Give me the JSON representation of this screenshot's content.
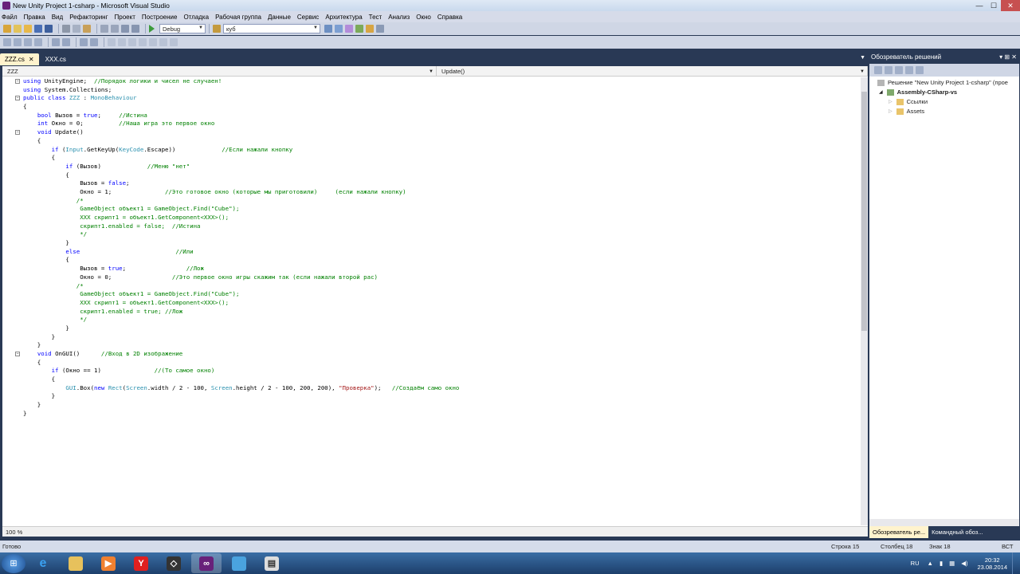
{
  "window": {
    "title": "New Unity Project 1-csharp - Microsoft Visual Studio",
    "minimize": "—",
    "maximize": "☐",
    "close": "✕"
  },
  "menu": [
    "Файл",
    "Правка",
    "Вид",
    "Рефакторинг",
    "Проект",
    "Построение",
    "Отладка",
    "Рабочая группа",
    "Данные",
    "Сервис",
    "Архитектура",
    "Тест",
    "Анализ",
    "Окно",
    "Справка"
  ],
  "toolbar": {
    "config": "Debug",
    "search": "куб"
  },
  "tabs": [
    {
      "label": "ZZZ.cs",
      "active": true,
      "close": "✕"
    },
    {
      "label": "XXX.cs",
      "active": false
    }
  ],
  "editor": {
    "nav_left": "ZZZ",
    "nav_right": "Update()",
    "zoom": "100 %",
    "code": [
      [
        [
          "kw",
          "using"
        ],
        [
          "pl",
          " UnityEngine;  "
        ],
        [
          "cm",
          "//Порядок логики и чисел не случаен!"
        ]
      ],
      [
        [
          "kw",
          "using"
        ],
        [
          "pl",
          " System.Collections;"
        ]
      ],
      [
        [
          "kw",
          "public"
        ],
        [
          "pl",
          " "
        ],
        [
          "kw",
          "class"
        ],
        [
          "pl",
          " "
        ],
        [
          "ty",
          "ZZZ"
        ],
        [
          "pl",
          " : "
        ],
        [
          "ty",
          "MonoBehaviour"
        ]
      ],
      [
        [
          "pl",
          "{"
        ]
      ],
      [
        [
          "pl",
          "    "
        ],
        [
          "kw",
          "bool"
        ],
        [
          "pl",
          " Вызов = "
        ],
        [
          "kw",
          "true"
        ],
        [
          "pl",
          ";     "
        ],
        [
          "cm",
          "//Истина"
        ]
      ],
      [
        [
          "pl",
          "    "
        ],
        [
          "kw",
          "int"
        ],
        [
          "pl",
          " Окно = 0;          "
        ],
        [
          "cm",
          "//Наша игра это первое окно"
        ]
      ],
      [
        [
          "pl",
          "    "
        ],
        [
          "kw",
          "void"
        ],
        [
          "pl",
          " Update()"
        ]
      ],
      [
        [
          "pl",
          "    {"
        ]
      ],
      [
        [
          "pl",
          "        "
        ],
        [
          "kw",
          "if"
        ],
        [
          "pl",
          " ("
        ],
        [
          "ty",
          "Input"
        ],
        [
          "pl",
          ".GetKeyUp("
        ],
        [
          "ty",
          "KeyCode"
        ],
        [
          "pl",
          ".Escape))             "
        ],
        [
          "cm",
          "//Если нажали кнопку"
        ]
      ],
      [
        [
          "pl",
          "        {"
        ]
      ],
      [
        [
          "pl",
          "            "
        ],
        [
          "kw",
          "if"
        ],
        [
          "pl",
          " (Вызов)             "
        ],
        [
          "cm",
          "//Меню \"нет\""
        ]
      ],
      [
        [
          "pl",
          "            {"
        ]
      ],
      [
        [
          "pl",
          "                Вызов = "
        ],
        [
          "kw",
          "false"
        ],
        [
          "pl",
          ";"
        ]
      ],
      [
        [
          "pl",
          "                Окно = 1;               "
        ],
        [
          "cm",
          "//Это готовое окно (которые мы приготовили)     (если нажали кнопку)"
        ]
      ],
      [
        [
          "cm",
          "               /*"
        ]
      ],
      [
        [
          "cm",
          "                GameObject объект1 = GameObject.Find(\"Cube\");"
        ]
      ],
      [
        [
          "cm",
          "                XXX скрипт1 = объект1.GetComponent<XXX>();"
        ]
      ],
      [
        [
          "cm",
          "                скрипт1.enabled = false;  //Истина"
        ]
      ],
      [
        [
          "cm",
          "                */"
        ]
      ],
      [
        [
          "pl",
          "            }"
        ]
      ],
      [
        [
          "pl",
          "            "
        ],
        [
          "kw",
          "else"
        ],
        [
          "pl",
          "                           "
        ],
        [
          "cm",
          "//Или"
        ]
      ],
      [
        [
          "pl",
          "            {"
        ]
      ],
      [
        [
          "pl",
          "                Вызов = "
        ],
        [
          "kw",
          "true"
        ],
        [
          "pl",
          ";                 "
        ],
        [
          "cm",
          "//Лож"
        ]
      ],
      [
        [
          "pl",
          "                Окно = 0;                 "
        ],
        [
          "cm",
          "//Это первое окно игры скажим так (если нажали второй рас)"
        ]
      ],
      [
        [
          "cm",
          "               /*"
        ]
      ],
      [
        [
          "cm",
          "                GameObject объект1 = GameObject.Find(\"Cube\");"
        ]
      ],
      [
        [
          "cm",
          "                XXX скрипт1 = объект1.GetComponent<XXX>();"
        ]
      ],
      [
        [
          "cm",
          "                скрипт1.enabled = true; //Лож"
        ]
      ],
      [
        [
          "cm",
          "                */"
        ]
      ],
      [
        [
          "pl",
          "            }"
        ]
      ],
      [
        [
          "pl",
          "        }"
        ]
      ],
      [
        [
          "pl",
          "    }"
        ]
      ],
      [
        [
          "pl",
          "    "
        ],
        [
          "kw",
          "void"
        ],
        [
          "pl",
          " OnGUI()      "
        ],
        [
          "cm",
          "//Вход в 2D изображение"
        ]
      ],
      [
        [
          "pl",
          "    {"
        ]
      ],
      [
        [
          "pl",
          "        "
        ],
        [
          "kw",
          "if"
        ],
        [
          "pl",
          " (Окно == 1)               "
        ],
        [
          "cm",
          "//(То самое окно)"
        ]
      ],
      [
        [
          "pl",
          "        {"
        ]
      ],
      [
        [
          "pl",
          "            "
        ],
        [
          "ty",
          "GUI"
        ],
        [
          "pl",
          ".Box("
        ],
        [
          "kw",
          "new"
        ],
        [
          "pl",
          " "
        ],
        [
          "ty",
          "Rect"
        ],
        [
          "pl",
          "("
        ],
        [
          "ty",
          "Screen"
        ],
        [
          "pl",
          ".width / 2 - 100, "
        ],
        [
          "ty",
          "Screen"
        ],
        [
          "pl",
          ".height / 2 - 100, 200, 200), "
        ],
        [
          "st",
          "\"Проверка\""
        ],
        [
          "pl",
          ");   "
        ],
        [
          "cm",
          "//Создаём само окно"
        ]
      ],
      [
        [
          "pl",
          "        }"
        ]
      ],
      [
        [
          "pl",
          "    }"
        ]
      ],
      [
        [
          "pl",
          "}"
        ]
      ]
    ]
  },
  "solution_explorer": {
    "title": "Обозреватель решений",
    "header_buttons": "▾ ⊞ ✕",
    "solution": "Решение \"New Unity Project 1-csharp\" (прое",
    "project": "Assembly-CSharp-vs",
    "items": [
      "Ссылки",
      "Assets"
    ],
    "tab_active": "Обозреватель ре...",
    "tab_other": "Командный обоз..."
  },
  "status": {
    "ready": "Готово",
    "line": "Строка 15",
    "col": "Столбец 18",
    "ch": "Знак 18",
    "mode": "ВСТ"
  },
  "taskbar": {
    "lang": "RU",
    "time": "20:32",
    "date": "23.08.2014"
  },
  "colors": {
    "keyword": "#0000ff",
    "comment": "#008000",
    "type": "#2b91af",
    "string": "#a31515",
    "chrome": "#293955",
    "active_tab": "#fff3cd"
  }
}
